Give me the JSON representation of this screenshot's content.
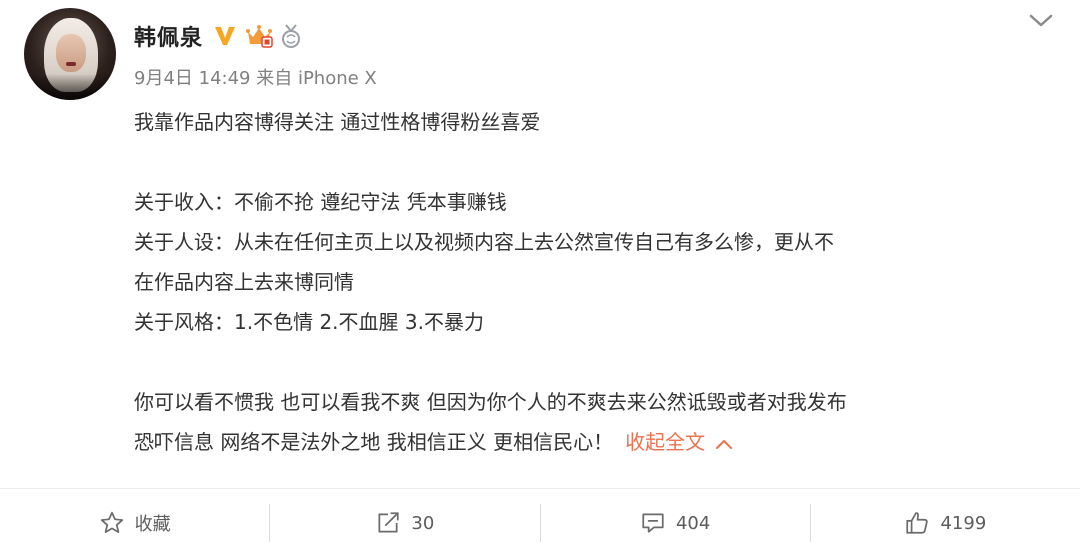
{
  "post": {
    "author": "韩佩泉",
    "meta": "9月4日 14:49 来自 iPhone X",
    "lines": {
      "p1": "我靠作品内容博得关注 通过性格博得粉丝喜爱",
      "p2": "关于收入：不偷不抢 遵纪守法 凭本事赚钱",
      "p3": "关于人设：从未在任何主页上以及视频内容上去公然宣传自己有多么惨，更从不",
      "p4": "在作品内容上去来博同情",
      "p5": "关于风格：1.不色情 2.不血腥 3.不暴力",
      "p6": "你可以看不惯我 也可以看我不爽 但因为你个人的不爽去来公然诋毁或者对我发布",
      "p7": "恐吓信息 网络不是法外之地 我相信正义 更相信民心！"
    },
    "collapse_label": "收起全文"
  },
  "actions": {
    "favorite_label": "收藏",
    "repost_count": "30",
    "comment_count": "404",
    "like_count": "4199"
  },
  "colors": {
    "link": "#eb7350",
    "verified_badge": "#f5a623",
    "text": "#333333",
    "meta": "#808080"
  },
  "icons": [
    "avatar",
    "verified-v-icon",
    "vip-crown-icon",
    "medal-icon",
    "chevron-down-icon",
    "chevron-up-icon",
    "star-icon",
    "repost-icon",
    "comment-icon",
    "like-icon"
  ]
}
